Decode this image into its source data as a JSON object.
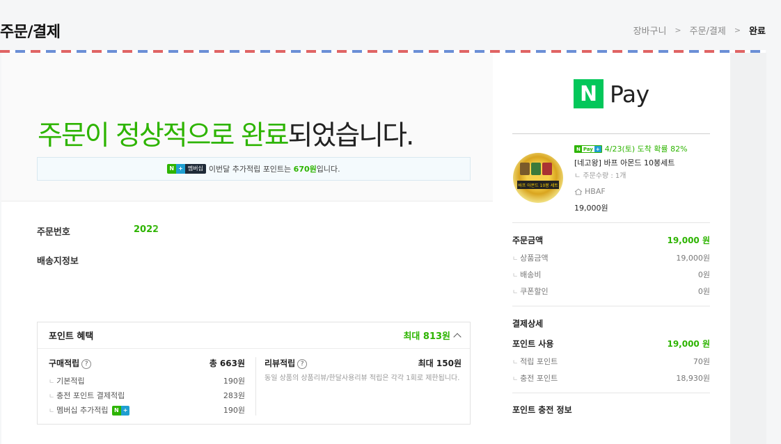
{
  "header": {
    "title": "주문/결제",
    "breadcrumb": [
      "장바구니",
      "주문/결제",
      "완료"
    ]
  },
  "main": {
    "headline_green": "주문이 정상적으로 완료",
    "headline_rest": "되었습니다.",
    "notice": {
      "badge_n": "N",
      "badge_plus": "+",
      "badge_text": "멤버십",
      "text_before": "이번달 추가적립 포인트는 ",
      "highlight": "670원",
      "text_after": "입니다."
    },
    "order_number_label": "주문번호",
    "order_number_value": "2022",
    "shipping_label": "배송지정보"
  },
  "points": {
    "title": "포인트 혜택",
    "max_label": "최대 813원",
    "purchase": {
      "title": "구매적립",
      "help": "?",
      "total": "총 663원",
      "rows": [
        {
          "label": "기본적립",
          "value": "190원"
        },
        {
          "label": "충전 포인트 결제적립",
          "value": "283원"
        },
        {
          "label": "멤버십 추가적립",
          "value": "190원"
        }
      ]
    },
    "review": {
      "title": "리뷰적립",
      "help": "?",
      "total": "최대 150원",
      "desc": "동일 상품의 상품리뷰/한달사용리뷰 적립은 각각 1회로 제한됩니다."
    }
  },
  "side": {
    "logo_n": "N",
    "logo_pay": "Pay",
    "delivery_badge": [
      "N",
      "Pay",
      "+"
    ],
    "delivery": "4/23(토) 도착 확률 82%",
    "product_name": "[네고왕] 바프 아몬드 10봉세트",
    "product_qty": "ㄴ 주문수량 : 1개",
    "seller": "HBAF",
    "product_price": "19,000원",
    "product_img_text": "바프 아몬드 10봉 세트",
    "order_amount_label": "주문금액",
    "order_amount_value": "19,000 원",
    "order_rows": [
      {
        "label": "상품금액",
        "value": "19,000원"
      },
      {
        "label": "배송비",
        "value": "0원"
      },
      {
        "label": "쿠폰할인",
        "value": "0원"
      }
    ],
    "payment_detail_label": "결제상세",
    "point_use_label": "포인트 사용",
    "point_use_value": "19,000 원",
    "point_rows": [
      {
        "label": "적립 포인트",
        "value": "70원"
      },
      {
        "label": "충전 포인트",
        "value": "18,930원"
      }
    ],
    "charge_info_label": "포인트 충전 정보"
  },
  "colors": {
    "green": "#2db400",
    "naver_green": "#03c75a",
    "blue": "#1f9fd1"
  }
}
